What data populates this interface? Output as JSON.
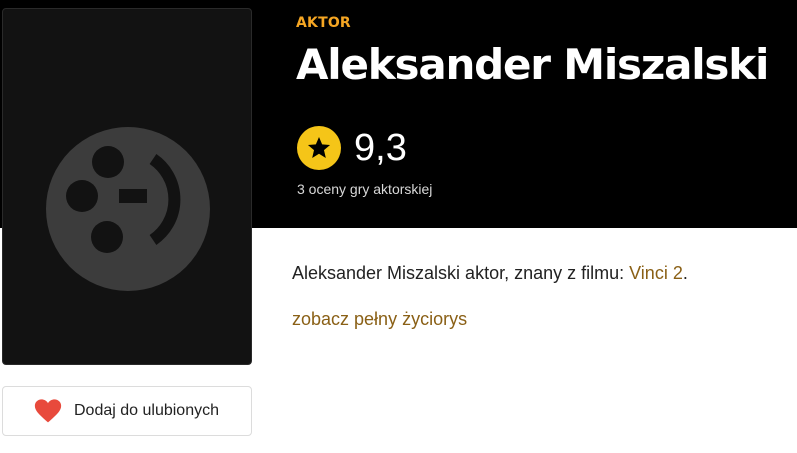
{
  "colors": {
    "accent": "#f5a623",
    "star_badge": "#f5c518",
    "link": "#8a6016",
    "heart": "#e84a3c"
  },
  "header": {
    "role": "AKTOR",
    "name": "Aleksander Miszalski",
    "rating": "9,3",
    "rating_count": "3 oceny gry aktorskiej",
    "rating_icon": "star-icon"
  },
  "poster": {
    "placeholder_icon": "film-reel-placeholder-icon"
  },
  "bio": {
    "prefix": "Aleksander Miszalski aktor, znany z filmu: ",
    "film_link": "Vinci 2",
    "suffix": ".",
    "full_bio_link": "zobacz pełny życiorys"
  },
  "favorite_button": {
    "label": "Dodaj do ulubionych",
    "icon": "heart-icon"
  }
}
